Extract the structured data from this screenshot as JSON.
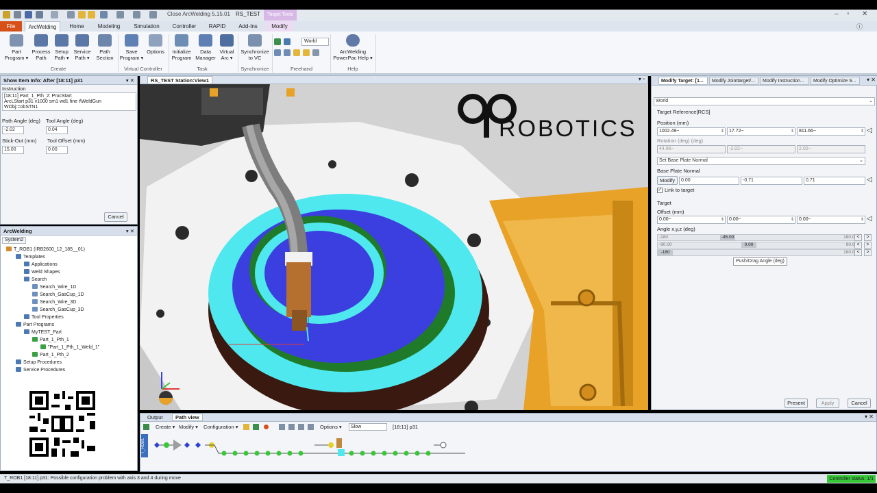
{
  "window": {
    "title": "Close ArcWelding 5.15.01",
    "station_tab": "RS_TEST",
    "context_tab": "Target Tools"
  },
  "ribbon_tabs": [
    "File",
    "ArcWelding",
    "Home",
    "Modeling",
    "Simulation",
    "Controller",
    "RAPID",
    "Add-Ins",
    "Modify"
  ],
  "ribbon": {
    "buttons": [
      {
        "label": "Part\nProgram ▾",
        "icon": "part-program-icon"
      },
      {
        "label": "Process\nPath",
        "icon": "process-path-icon"
      },
      {
        "label": "Setup\nPath ▾",
        "icon": "setup-path-icon"
      },
      {
        "label": "Service\nPath ▾",
        "icon": "service-path-icon"
      },
      {
        "label": "Path\nSection",
        "icon": "path-section-icon"
      },
      {
        "label": "Save\nProgram ▾",
        "icon": "save-program-icon"
      },
      {
        "label": "Options",
        "icon": "options-icon"
      },
      {
        "label": "Initialize\nProgram",
        "icon": "initialize-program-icon"
      },
      {
        "label": "Data\nManager",
        "icon": "data-manager-icon"
      },
      {
        "label": "Virtual\nArc ▾",
        "icon": "virtual-arc-icon"
      },
      {
        "label": "Synchronize\nto VC",
        "icon": "synchronize-icon"
      },
      {
        "label": "ArcWelding\nPowerPac Help ▾",
        "icon": "help-icon"
      }
    ],
    "groups": [
      "Create",
      "Virtual Controller",
      "Task",
      "Synchronize",
      "Freehand",
      "Help"
    ],
    "freehand_frame": "World"
  },
  "show_item_info": {
    "title": "Show Item Info: After [18:11] p31",
    "instruction_label": "Instruction",
    "instruction_lines": [
      "[18:11]  Part_1_Pth_2:  ProcStart",
      "ArcLStart  p31 v1000 sm1 wd1 fine t\\WeldGun",
      "WObj:=obSTN1"
    ],
    "path_angle_label": "Path Angle (deg)",
    "path_angle": "-2.02",
    "tool_angle_label": "Tool Angle (deg)",
    "tool_angle": "0.04",
    "stick_out_label": "Stick-Out (mm)",
    "stick_out": "15.00",
    "tool_offset_label": "Tool Offset (mm)",
    "tool_offset": "0.00",
    "cancel": "Cancel"
  },
  "arcwelding_panel": {
    "title": "ArcWelding",
    "tab": "System2",
    "tree": [
      "T_ROB1 (IRB2600_12_185__01)",
      "Templates",
      "Applications",
      "Weld Shapes",
      "Search",
      "Search_Wire_1D",
      "Search_GasCup_1D",
      "Search_Wire_3D",
      "Search_GasCup_3D",
      "Tool Properties",
      "Part Programs",
      "MyTEST_Part",
      "Part_1_Pth_1",
      "\"Part_1_Pth_1_Weld_1\"",
      "Part_1_Pth_2",
      "Setup Procedures",
      "Service Procedures"
    ]
  },
  "viewport": {
    "tab": "RS_TEST Station:View1",
    "watermark": "ROBOTICS"
  },
  "modify_target": {
    "tabs": [
      "Modify Target: [1...",
      "Modify Jointtarget/...",
      "Modify Instruction...",
      "Modify Optimize S..."
    ],
    "frame": "World",
    "target_reference": "Target Reference[RCS]",
    "position_label": "Position (mm)",
    "position": [
      "1002.49~",
      "17.72~",
      "811.66~"
    ],
    "rotation_label": "Rotation (deg) (deg)",
    "rotation": [
      "44.96~",
      "-2.02~",
      "2.02~"
    ],
    "base_plate_mode": "Set Base Plate Normal",
    "base_plate_label": "Base Plate Normal",
    "modify_button": "Modify",
    "base_plate": [
      "0.00",
      "-0.71",
      "0.71"
    ],
    "link_to_target": "Link to target",
    "target_label": "Target",
    "offset_label": "Offset (mm)",
    "offset": [
      "0.00~",
      "0.00~",
      "0.00~"
    ],
    "angle_label": "Angle x,y,z (deg)",
    "angles": [
      {
        "min": "-180",
        "max": "180.00",
        "value": "-45.00",
        "fraction": 0.375
      },
      {
        "min": "-90.00",
        "max": "90.00",
        "value": "0.00",
        "fraction": 0.5
      },
      {
        "min": "-180",
        "max": "180.00",
        "value": "",
        "fraction": 0.0
      }
    ],
    "tooltip": "Push/Drag Angle (deg)",
    "present": "Present",
    "apply": "Apply",
    "cancel": "Cancel"
  },
  "path_view": {
    "tabs": [
      "Output",
      "Path view"
    ],
    "create": "Create ▾",
    "modify": "Modify ▾",
    "configuration": "Configuration ▾",
    "options": "Options ▾",
    "speed": "Slow",
    "current": "[18:11] p31",
    "robot_label": "T_ROB1"
  },
  "status": {
    "message": "T_ROB1 [18:11] p31: Possible configuration problem with axis 3 and 4 during move",
    "controller": "Controller status: 1/1"
  },
  "colors": {
    "file_tab": "#d6501a",
    "cyan_ring": "#4fe8ee",
    "blue_ring": "#3b3fe0",
    "fixture_orange": "#e8a228",
    "status_green": "#37c837"
  }
}
